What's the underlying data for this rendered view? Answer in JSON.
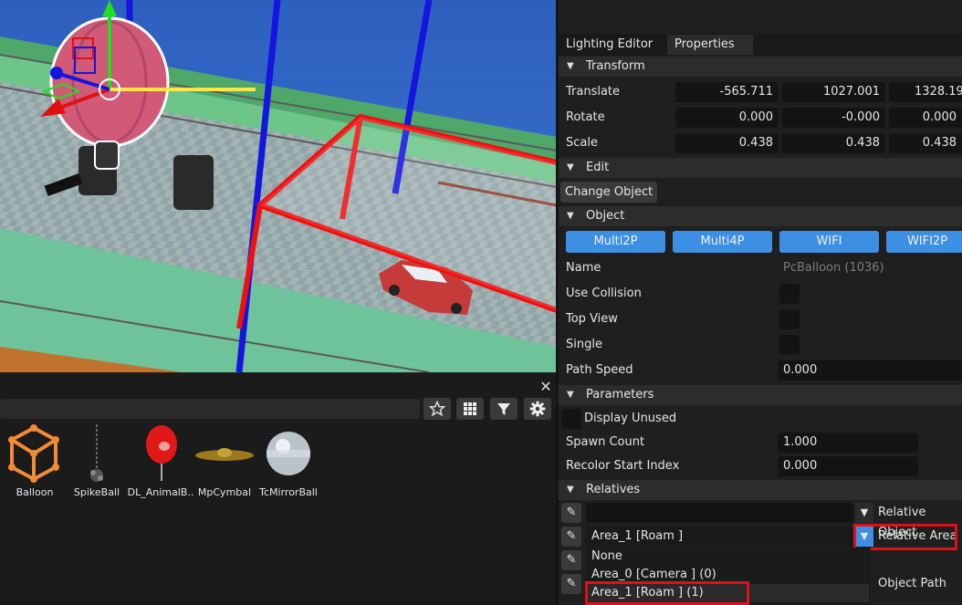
{
  "tabs": [
    {
      "label": "Lighting Editor"
    },
    {
      "label": "Properties"
    }
  ],
  "sections": {
    "transform": "Transform",
    "edit": "Edit",
    "object": "Object",
    "parameters": "Parameters",
    "relatives": "Relatives"
  },
  "transform": {
    "translate": {
      "label": "Translate",
      "x": "-565.711",
      "y": "1027.001",
      "z": "1328.19"
    },
    "rotate": {
      "label": "Rotate",
      "x": "0.000",
      "y": "-0.000",
      "z": "0.000"
    },
    "scale": {
      "label": "Scale",
      "x": "0.438",
      "y": "0.438",
      "z": "0.438"
    }
  },
  "edit": {
    "change_object": "Change Object"
  },
  "object": {
    "buttons": [
      "Multi2P",
      "Multi4P",
      "WIFI",
      "WIFI2P"
    ],
    "name_label": "Name",
    "name_value": "PcBalloon (1036)",
    "use_collision": "Use Collision",
    "top_view": "Top View",
    "single": "Single",
    "path_speed_label": "Path Speed",
    "path_speed_value": "0.000"
  },
  "parameters": {
    "display_unused": "Display Unused",
    "spawn_count_label": "Spawn Count",
    "spawn_count_value": "1.000",
    "recolor_label": "Recolor Start Index",
    "recolor_value": "0.000"
  },
  "relatives": {
    "relative_object": "Relative Object",
    "relative_area": "Relative Area",
    "area_value": "Area_1 [Roam ]",
    "object_path": "Object Path",
    "dropdown_options": [
      "None",
      "Area_0 [Camera ] (0)",
      "Area_1 [Roam ] (1)"
    ]
  },
  "assets": [
    {
      "label": "Balloon",
      "icon": "cube-icon"
    },
    {
      "label": "SpikeBall",
      "icon": "spikeball-icon"
    },
    {
      "label": "DL_AnimalB..",
      "icon": "red-balloon-icon"
    },
    {
      "label": "MpCymbal",
      "icon": "cymbal-icon"
    },
    {
      "label": "TcMirrorBall",
      "icon": "mirrorball-icon"
    }
  ],
  "colors": {
    "accent": "#3d8fe3",
    "highlight": "#e0101a"
  }
}
